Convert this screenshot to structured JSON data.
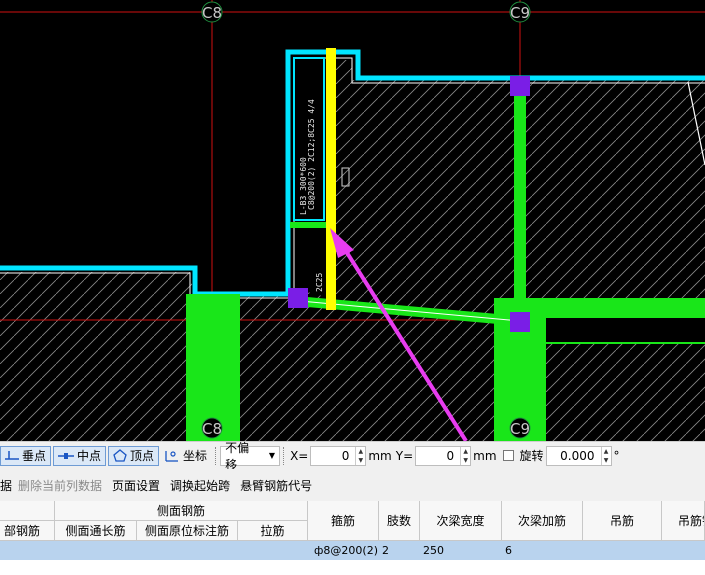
{
  "canvas": {
    "axis_labels": [
      "C8",
      "C9",
      "C8",
      "C9"
    ],
    "beam_annotation_line1": "L-B3 300*600",
    "beam_annotation_line2": "C8@200(2) 2C12;8C25 4/4",
    "beam_annotation_line3": "2C25",
    "colors": {
      "background": "#000000",
      "axis_line": "#d01010",
      "wall_outline": "#00e5ff",
      "green_fill": "#19e619",
      "column_fill": "#7a1ee6",
      "yellow_beam": "#ffff00",
      "arrow": "#e83cf0"
    }
  },
  "snapbar": {
    "perpendicular_label": "垂点",
    "midpoint_label": "中点",
    "vertex_label": "顶点",
    "coordinate_label": "坐标",
    "offset_value": "不偏移",
    "x_label": "X=",
    "x_value": "0",
    "y_label": "Y=",
    "y_value": "0",
    "mm_label": "mm",
    "mm_label_2": "mm",
    "rotate_label": "旋转",
    "rotate_value": "0.000",
    "degree_symbol": "°"
  },
  "tablebar": {
    "items": [
      "据",
      "删除当前列数据",
      "页面设置",
      "调换起始跨",
      "悬臂钢筋代号"
    ]
  },
  "grid": {
    "header_top": {
      "col0": "",
      "side_rebar": "侧面钢筋"
    },
    "header_bottom": {
      "col0": "部钢筋",
      "side_through": "侧面通长筋",
      "side_original": "侧面原位标注筋",
      "tie": "拉筋"
    },
    "header_merged": [
      "箍筋",
      "肢数",
      "次梁宽度",
      "次梁加筋",
      "吊筋",
      "吊筋锚"
    ],
    "row": {
      "stirrup": "ф8@200(2)",
      "legs": "2",
      "sec_width": "250",
      "sec_add": "6"
    }
  }
}
